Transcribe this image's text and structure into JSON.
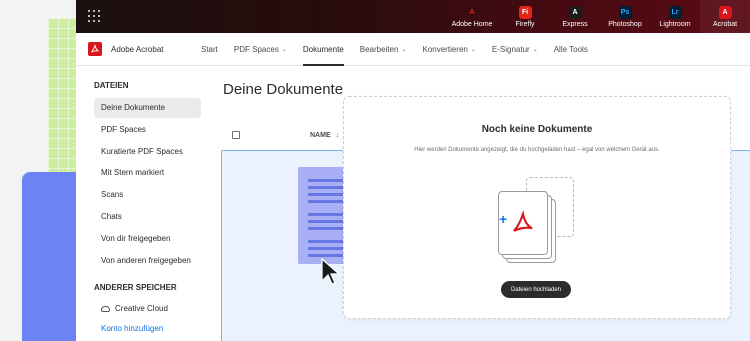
{
  "top_bar": {
    "apps": [
      {
        "label": "Adobe Home",
        "icon": "adobe-logo-icon",
        "tile": "A",
        "color": "#e1251b",
        "bg": "transparent"
      },
      {
        "label": "Firefly",
        "icon": "firefly-icon",
        "tile": "Fi",
        "color": "#ffffff",
        "bg": "#e1251b"
      },
      {
        "label": "Express",
        "icon": "express-icon",
        "tile": "A",
        "color": "#ffffff",
        "bg": "#1b1b1b"
      },
      {
        "label": "Photoshop",
        "icon": "photoshop-icon",
        "tile": "Ps",
        "color": "#31a8ff",
        "bg": "#001e36"
      },
      {
        "label": "Lightroom",
        "icon": "lightroom-icon",
        "tile": "Lr",
        "color": "#31a8ff",
        "bg": "#001e36"
      },
      {
        "label": "Acrobat",
        "icon": "acrobat-icon",
        "tile": "A",
        "color": "#ffffff",
        "bg": "#d9161c"
      }
    ]
  },
  "subnav": {
    "brand": "Adobe Acrobat",
    "links": [
      {
        "label": "Start",
        "dropdown": false,
        "active": false
      },
      {
        "label": "PDF Spaces",
        "dropdown": true,
        "active": false
      },
      {
        "label": "Dokumente",
        "dropdown": false,
        "active": true
      },
      {
        "label": "Bearbeiten",
        "dropdown": true,
        "active": false
      },
      {
        "label": "Konvertieren",
        "dropdown": true,
        "active": false
      },
      {
        "label": "E-Signatur",
        "dropdown": true,
        "active": false
      },
      {
        "label": "Alle Tools",
        "dropdown": false,
        "active": false
      }
    ]
  },
  "sidebar": {
    "section1": "DATEIEN",
    "items": [
      "Deine Dokumente",
      "PDF Spaces",
      "Kuratierte PDF Spaces",
      "Mit Stern markiert",
      "Scans",
      "Chats",
      "Von dir freigegeben",
      "Von anderen freigegeben"
    ],
    "active_index": 0,
    "section2": "ANDERER SPEICHER",
    "storage_item": "Creative Cloud",
    "add_link": "Konto hinzufügen"
  },
  "main": {
    "title": "Deine Dokumente",
    "column_name": "NAME",
    "empty_title": "Noch keine Dokumente",
    "empty_subtitle": "Hier werden Dokumente angezeigt, die du hochgeladen hast – egal von welchem Gerät aus.",
    "upload_button": "Dateien hochladen"
  },
  "colors": {
    "accent_blue": "#1473e6",
    "acrobat_red": "#d9161c",
    "dropzone_bg": "#eaf2fd",
    "document_purple": "#a9aff5"
  }
}
